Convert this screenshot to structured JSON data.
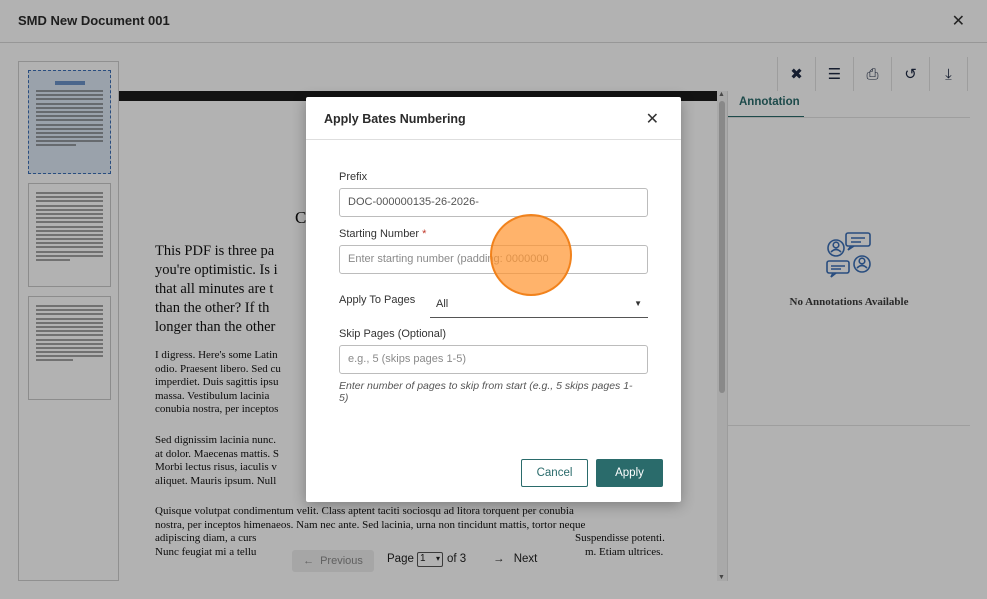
{
  "window": {
    "title": "SMD New Document 001"
  },
  "document": {
    "heading": "C",
    "big_lines": [
      "This PDF is three pa",
      "you're optimistic. Is i",
      "that all minutes are t",
      "than the other? If th",
      "longer than the other"
    ],
    "para1": [
      "I digress. Here's some Latin",
      "odio. Praesent libero. Sed cu",
      "imperdiet. Duis sagittis ipsu",
      "massa. Vestibulum lacinia",
      "conubia nostra, per inceptos"
    ],
    "para2": [
      "Sed dignissim lacinia nunc.",
      "at dolor. Maecenas mattis. S",
      "Morbi lectus risus, iaculis v",
      "aliquet. Mauris ipsum. Null"
    ],
    "para3": [
      "Quisque volutpat condimentum velit. Class aptent taciti sociosqu ad litora torquent per conubia",
      "nostra, per inceptos himenaeos. Nam nec ante. Sed lacinia, urna non tincidunt mattis, tortor neque",
      "adipiscing diam, a curs",
      "Nunc feugiat mi a tellu"
    ],
    "para3_tail": [
      "Suspendisse potenti.",
      "m. Etiam ultrices."
    ]
  },
  "toolbar": {
    "icons": [
      "tools-icon",
      "list-icon",
      "print-icon",
      "history-icon",
      "download-icon"
    ]
  },
  "annotation_panel": {
    "tab_label": "Annotation",
    "empty_text": "No Annotations Available"
  },
  "pager": {
    "previous": "Previous",
    "page_label": "Page",
    "current_page": "1",
    "of_label": "of 3",
    "next": "Next"
  },
  "modal": {
    "title": "Apply Bates Numbering",
    "prefix": {
      "label": "Prefix",
      "value": "DOC-000000135-26-2026-"
    },
    "starting_number": {
      "label": "Starting Number",
      "required_mark": "*",
      "placeholder": "Enter starting number (padding: 0000000"
    },
    "apply_to_pages": {
      "label": "Apply To Pages",
      "value": "All"
    },
    "skip_pages": {
      "label": "Skip Pages (Optional)",
      "placeholder": "e.g., 5 (skips pages 1-5)"
    },
    "hint": "Enter number of pages to skip from start (e.g., 5 skips pages 1-5)",
    "cancel": "Cancel",
    "apply": "Apply"
  },
  "colors": {
    "accent": "#2a6b6b",
    "required": "#c0392b",
    "cursor": "#ff9632"
  }
}
